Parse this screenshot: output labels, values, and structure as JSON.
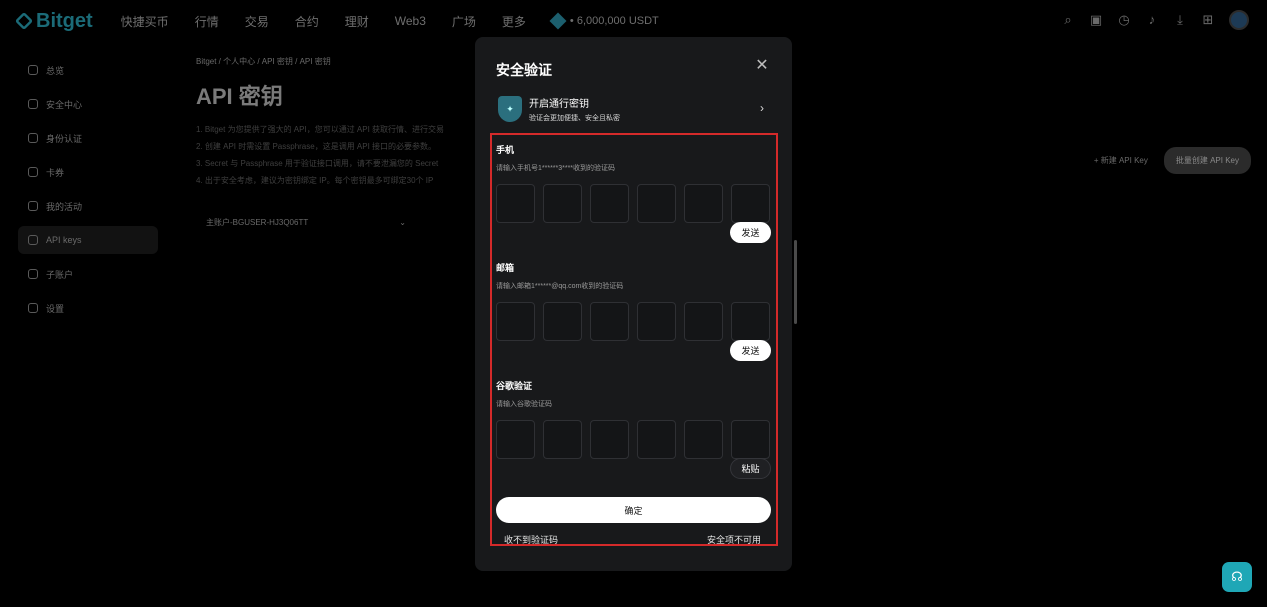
{
  "topnav": {
    "logo": "Bitget",
    "items": [
      "快捷买币",
      "行情",
      "交易",
      "合约",
      "理财",
      "Web3",
      "广场",
      "更多"
    ],
    "promo": "• 6,000,000 USDT"
  },
  "sidebar": {
    "items": [
      {
        "label": "总览"
      },
      {
        "label": "安全中心"
      },
      {
        "label": "身份认证"
      },
      {
        "label": "卡券"
      },
      {
        "label": "我的活动"
      },
      {
        "label": "API keys"
      },
      {
        "label": "子账户"
      },
      {
        "label": "设置"
      }
    ]
  },
  "main": {
    "breadcrumb": "Bitget  /  个人中心  /  API 密钥  /  API 密钥",
    "title": "API 密钥",
    "notes": [
      "1. Bitget 为您提供了强大的 API，您可以通过 API 获取行情、进行交易",
      "2. 创建 API 时需设置 Passphrase，这是调用 API 接口的必要参数。",
      "3. Secret 与 Passphrase 用于验证接口调用，请不要泄漏您的 Secret",
      "4. 出于安全考虑，建议为密钥绑定 IP。每个密钥最多可绑定30个 IP"
    ],
    "account_select": "主账户-BGUSER-HJ3Q06TT",
    "new_key": "+ 新建 API Key",
    "batch_create": "批量创建 API Key"
  },
  "modal": {
    "title": "安全验证",
    "passkey_title": "开启通行密钥",
    "passkey_subtitle": "验证会更加便捷、安全且私密",
    "phone": {
      "label": "手机",
      "hint": "请输入手机号1******3****收到的验证码",
      "button": "发送"
    },
    "email": {
      "label": "邮箱",
      "hint": "请输入邮箱1******@qq.com收到的验证码",
      "button": "发送"
    },
    "google": {
      "label": "谷歌验证",
      "hint": "请输入谷歌验证码",
      "button": "粘贴"
    },
    "confirm": "确定",
    "no_code": "收不到验证码",
    "unavailable": "安全项不可用"
  }
}
